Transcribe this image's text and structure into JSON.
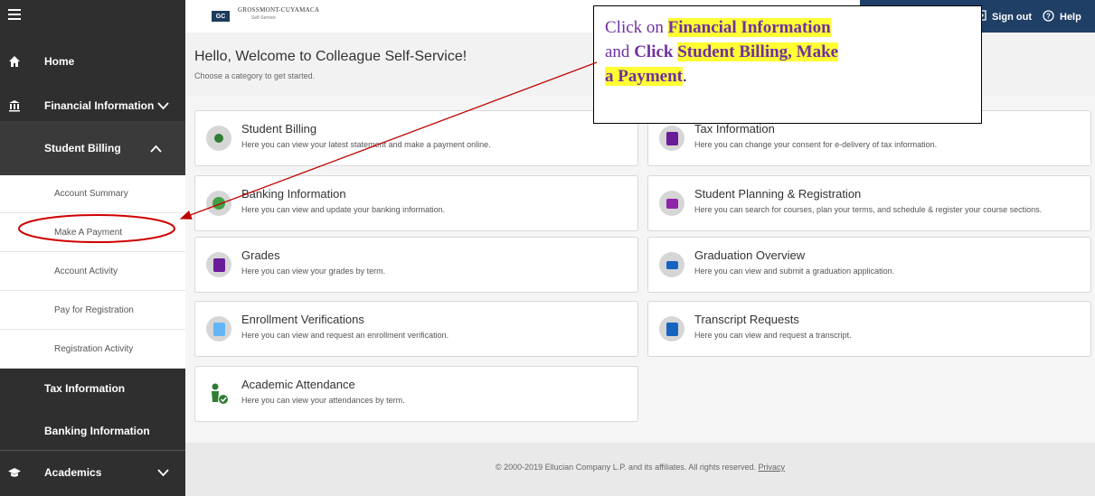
{
  "topbar": {
    "logo_box": "GC",
    "logo_text": "GROSSMONT-CUYAMACA",
    "logo_sub": "Self-Service",
    "sign_out": "Sign out",
    "help": "Help"
  },
  "sidebar": {
    "home": "Home",
    "financial": "Financial Information",
    "student_billing": "Student Billing",
    "sub_items": [
      "Account Summary",
      "Make A Payment",
      "Account Activity",
      "Pay for Registration",
      "Registration Activity"
    ],
    "tax": "Tax Information",
    "banking": "Banking Information",
    "academics": "Academics"
  },
  "welcome": {
    "title": "Hello, Welcome to Colleague Self-Service!",
    "subtitle": "Choose a category to get started."
  },
  "cards": [
    {
      "title": "Student Billing",
      "desc": "Here you can view your latest statement and make a payment online.",
      "icon": "dollar-icon",
      "color": "#2e7d32"
    },
    {
      "title": "Tax Information",
      "desc": "Here you can change your consent for e-delivery of tax information.",
      "icon": "tax-document-icon",
      "color": "#6a1b9a"
    },
    {
      "title": "Banking Information",
      "desc": "Here you can view and update your banking information.",
      "icon": "bank-icon",
      "color": "#43a047"
    },
    {
      "title": "Student Planning & Registration",
      "desc": "Here you can search for courses, plan your terms, and schedule & register your course sections.",
      "icon": "calendar-icon",
      "color": "#8e24aa"
    },
    {
      "title": "Grades",
      "desc": "Here you can view your grades by term.",
      "icon": "grades-icon",
      "color": "#6a1b9a"
    },
    {
      "title": "Graduation Overview",
      "desc": "Here you can view and submit a graduation application.",
      "icon": "graduation-cap-icon",
      "color": "#1565c0"
    },
    {
      "title": "Enrollment Verifications",
      "desc": "Here you can view and request an enrollment verification.",
      "icon": "verification-icon",
      "color": "#64b5f6"
    },
    {
      "title": "Transcript Requests",
      "desc": "Here you can view and request a transcript.",
      "icon": "transcript-icon",
      "color": "#1565c0"
    },
    {
      "title": "Academic Attendance",
      "desc": "Here you can view your attendances by term.",
      "icon": "attendance-icon",
      "color": "#2e7d32"
    }
  ],
  "footer": {
    "text": "© 2000-2019 Ellucian Company L.P. and its affiliates. All rights reserved.",
    "privacy": "Privacy"
  },
  "callout": {
    "line1a": "Click on ",
    "line1b": "Financial Information",
    "line2a": "and ",
    "line2b": "Click ",
    "line2c": "Student Billing, Make",
    "line3a": "a Payment",
    "line3b": "."
  },
  "colors": {
    "sidebar_dark": "#2f2f2f",
    "topbar_right": "#1f3f66",
    "callout_text": "#7030a0",
    "highlight": "#ffff33",
    "annotation_red": "#c00000"
  }
}
